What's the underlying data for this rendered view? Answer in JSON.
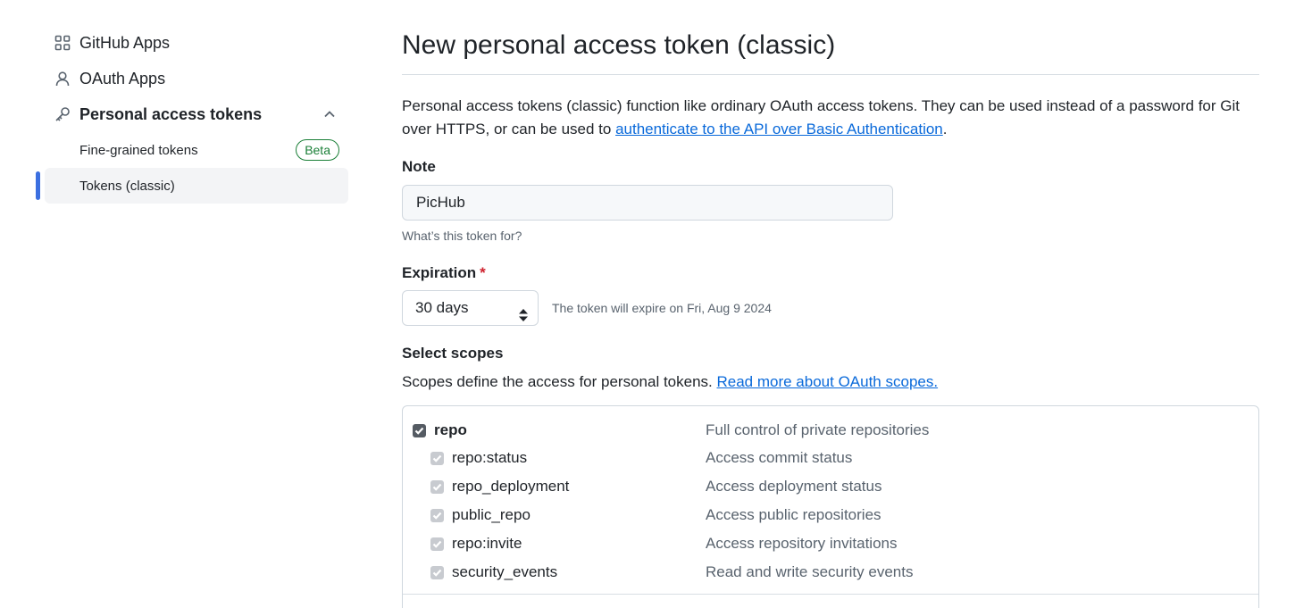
{
  "sidebar": {
    "items": [
      {
        "label": "GitHub Apps",
        "icon": "apps-grid-icon"
      },
      {
        "label": "OAuth Apps",
        "icon": "person-icon"
      },
      {
        "label": "Personal access tokens",
        "icon": "key-icon",
        "expanded": true
      }
    ],
    "sub_items": [
      {
        "label": "Fine-grained tokens",
        "badge": "Beta",
        "active": false
      },
      {
        "label": "Tokens (classic)",
        "active": true
      }
    ],
    "accent": "#3b6fe0"
  },
  "main": {
    "title": "New personal access token (classic)",
    "intro_text": "Personal access tokens (classic) function like ordinary OAuth access tokens. They can be used instead of a password for Git over HTTPS, or can be used to ",
    "intro_link": "authenticate to the API over Basic Authentication",
    "intro_end": ".",
    "note": {
      "label": "Note",
      "value": "PicHub",
      "hint": "What’s this token for?"
    },
    "expiration": {
      "label": "Expiration",
      "required_mark": "*",
      "selected": "30 days",
      "note": "The token will expire on Fri, Aug 9 2024"
    },
    "scopes": {
      "label": "Select scopes",
      "description": "Scopes define the access for personal tokens. ",
      "link": "Read more about OAuth scopes.",
      "items": [
        {
          "name": "repo",
          "description": "Full control of private repositories",
          "checked": true,
          "parent": true
        },
        {
          "name": "repo:status",
          "description": "Access commit status",
          "checked": true
        },
        {
          "name": "repo_deployment",
          "description": "Access deployment status",
          "checked": true
        },
        {
          "name": "public_repo",
          "description": "Access public repositories",
          "checked": true
        },
        {
          "name": "repo:invite",
          "description": "Access repository invitations",
          "checked": true
        },
        {
          "name": "security_events",
          "description": "Read and write security events",
          "checked": true
        }
      ]
    }
  },
  "colors": {
    "link": "#0969da",
    "badge_green": "#1a7f37",
    "required_red": "#cf222e"
  }
}
